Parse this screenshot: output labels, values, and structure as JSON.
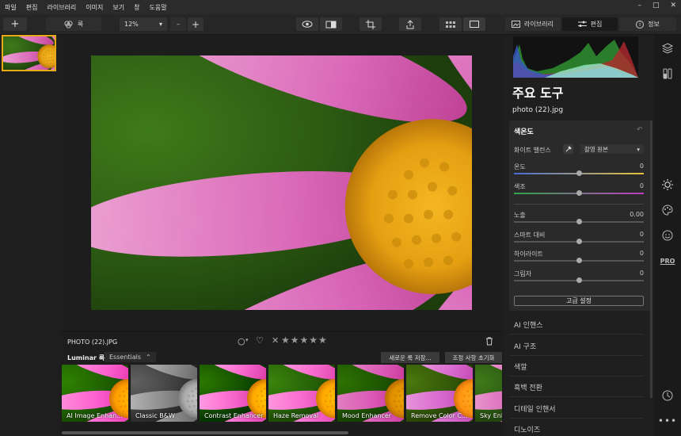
{
  "menu": [
    "파일",
    "편집",
    "라이브러리",
    "이미지",
    "보기",
    "창",
    "도움말"
  ],
  "window_controls": [
    "–",
    "□",
    "✕"
  ],
  "toolbar": {
    "add": "+",
    "looks_label": "룩",
    "zoom": "12%",
    "zoom_out": "–",
    "zoom_in": "+",
    "tab_library": "라이브러리",
    "tab_edit": "편집",
    "tab_info": "정보"
  },
  "panel": {
    "title": "주요 도구",
    "filename": "photo (22).jpg",
    "color_section": "색온도",
    "white_balance_label": "화이트 밸런스",
    "white_balance_value": "촬영 원본",
    "sliders": [
      {
        "label": "온도",
        "value": "0",
        "level": 0.5
      },
      {
        "label": "색조",
        "value": "0",
        "level": 0.5
      },
      {
        "label": "노출",
        "value": "0.00",
        "level": 0.5
      },
      {
        "label": "스마트 대비",
        "value": "0",
        "level": 0.5
      },
      {
        "label": "하이라이트",
        "value": "0",
        "level": 0.5
      },
      {
        "label": "그림자",
        "value": "0",
        "level": 0.5
      }
    ],
    "advanced_button": "고급 설정",
    "sections": [
      "AI 인핸스",
      "AI 구조",
      "색깔",
      "흑백 전환",
      "디테일 인핸서",
      "디노이즈"
    ]
  },
  "info": {
    "photo_name": "PHOTO (22).JPG",
    "stars": "★★★★★"
  },
  "looks": {
    "label": "Luminar 룩:",
    "category": "Essentials",
    "save_button": "새로운 룩 저장...",
    "reset_button": "조정 사항 초기화",
    "items": [
      "AI Image Enhan...",
      "Classic B&W",
      "Contrast Enhancer",
      "Haze Removal",
      "Mood Enhancer",
      "Remove Color C...",
      "Sky Enha"
    ]
  },
  "right_icons": [
    "layers-icon",
    "adjust-icon",
    "sun-icon",
    "palette-icon",
    "smile-icon",
    "pro-icon",
    "history-icon",
    "more-icon"
  ],
  "pro_label": "PRO",
  "colors": {
    "accent": "#e7a91a",
    "panel": "#2a2a2a",
    "background": "#1c1c1c"
  }
}
